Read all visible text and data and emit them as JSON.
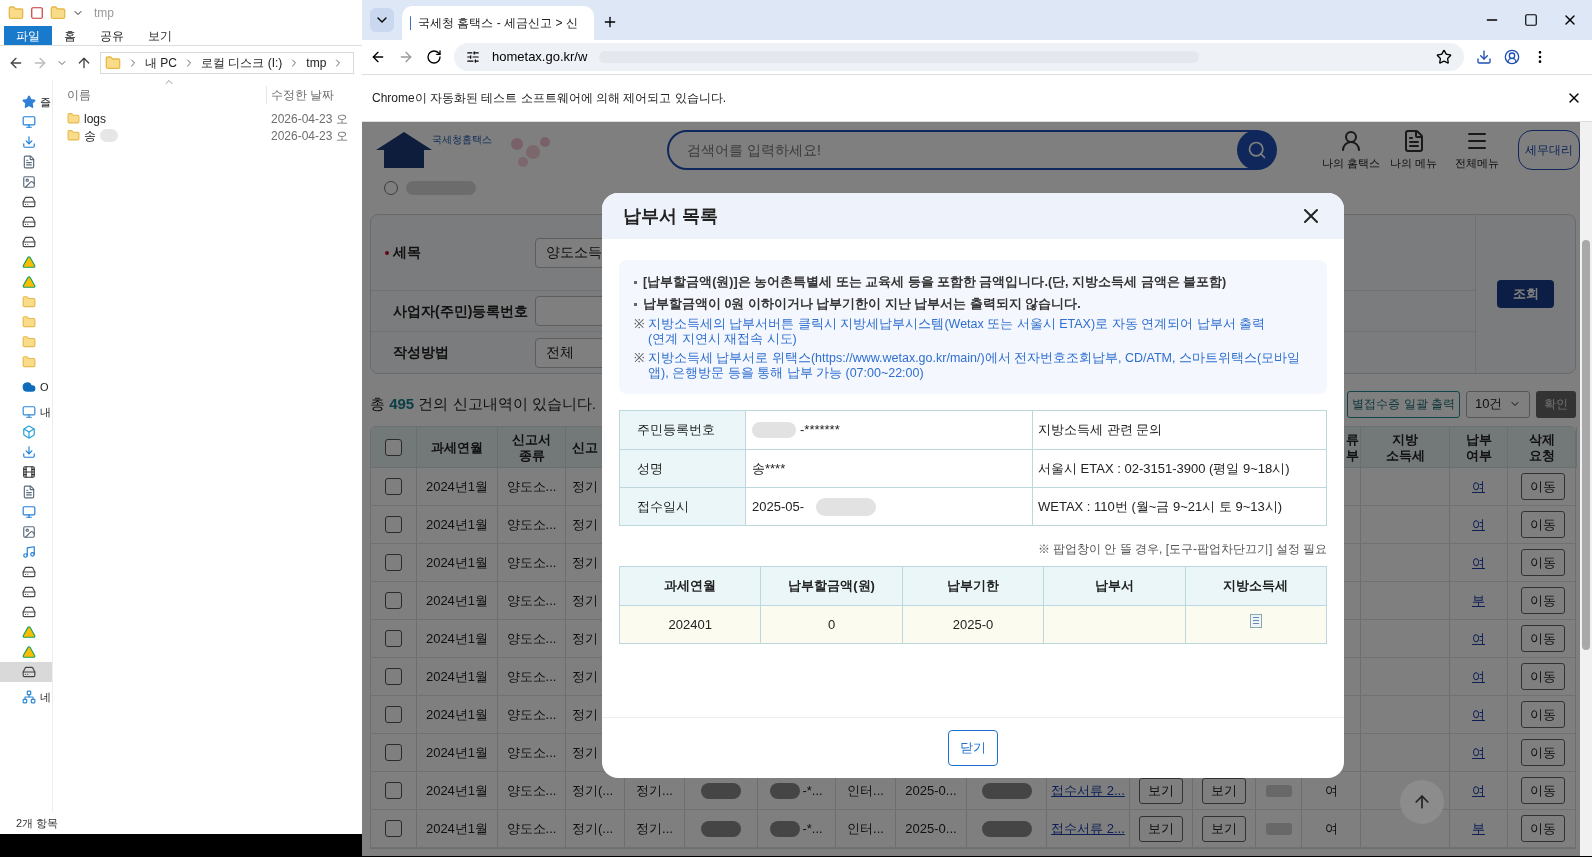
{
  "explorer": {
    "title": "tmp",
    "ribbon_tabs": [
      {
        "label": "파일",
        "selected": true
      },
      {
        "label": "홈",
        "selected": false
      },
      {
        "label": "공유",
        "selected": false
      },
      {
        "label": "보기",
        "selected": false
      }
    ],
    "breadcrumb": [
      "내 PC",
      "로컬 디스크 (I:)",
      "tmp"
    ],
    "columns": [
      "이름",
      "수정한 날짜"
    ],
    "files": [
      {
        "name": "logs",
        "modified": "2026-04-23 오",
        "redacted": false
      },
      {
        "name": "송",
        "modified": "2026-04-23 오",
        "redacted": true
      }
    ],
    "nav": [
      {
        "kind": "star",
        "label": "즐",
        "selected": false
      },
      {
        "kind": "desktop",
        "selected": false
      },
      {
        "kind": "download",
        "selected": false
      },
      {
        "kind": "document",
        "selected": false
      },
      {
        "kind": "picture",
        "selected": false
      },
      {
        "kind": "netdrive",
        "selected": false
      },
      {
        "kind": "netdrive",
        "selected": false
      },
      {
        "kind": "netdrive",
        "selected": false
      },
      {
        "kind": "gdrive",
        "selected": false
      },
      {
        "kind": "gdrive",
        "selected": false
      },
      {
        "kind": "cloudfolder",
        "selected": false
      },
      {
        "kind": "folder",
        "selected": false
      },
      {
        "kind": "folder",
        "selected": false
      },
      {
        "kind": "folder",
        "selected": false
      },
      {
        "kind": "onedrive",
        "label": "O",
        "selected": false
      },
      {
        "kind": "pc",
        "label": "내",
        "selected": false
      },
      {
        "kind": "cube",
        "selected": false
      },
      {
        "kind": "download",
        "selected": false
      },
      {
        "kind": "film",
        "selected": false
      },
      {
        "kind": "document",
        "selected": false
      },
      {
        "kind": "desktop",
        "selected": false
      },
      {
        "kind": "picture",
        "selected": false
      },
      {
        "kind": "music",
        "selected": false
      },
      {
        "kind": "drive",
        "selected": false
      },
      {
        "kind": "drive",
        "selected": false
      },
      {
        "kind": "drive",
        "selected": false
      },
      {
        "kind": "gdrive",
        "selected": false
      },
      {
        "kind": "gdrive",
        "selected": false
      },
      {
        "kind": "drive",
        "selected": true
      },
      {
        "kind": "network",
        "label": "네",
        "selected": false
      }
    ],
    "status": "2개 항목"
  },
  "browser": {
    "tab_title": "국세청 홈택스 - 세금신고 > 신",
    "url": "hometax.go.kr/w",
    "infobar": "Chrome이 자동화된 테스트 소프트웨어에 의해 제어되고 있습니다."
  },
  "site": {
    "logo_text": "국세청홈택스",
    "search_placeholder": "검색어를 입력하세요!",
    "nav": [
      {
        "kind": "user",
        "label": "나의 홈택스"
      },
      {
        "kind": "menu-user",
        "label": "나의 메뉴"
      },
      {
        "kind": "hamburger",
        "label": "전체메뉴"
      }
    ],
    "agent_button": "세무대리"
  },
  "filters": [
    {
      "label": "세목",
      "required": true,
      "kind": "select",
      "value": "양도소득"
    },
    {
      "label": "사업자(주민)등록번호",
      "required": false,
      "kind": "input"
    },
    {
      "label": "작성방법",
      "required": false,
      "kind": "select",
      "value": "전체"
    }
  ],
  "search_button": "조회",
  "summary": {
    "prefix": "총",
    "count": "495",
    "suffix": "건의 신고내역이 있습니다."
  },
  "bulk_print_button": "별접수증 일괄 출력",
  "page_size": "10건",
  "confirm_button": "확인",
  "table": {
    "header_checked": false,
    "columns": [
      "과세연월",
      "신고서\n종류",
      "신고",
      "류\n부",
      "지방\n소득세",
      "납부\n여부",
      "삭제\n요청"
    ],
    "rows": [
      {
        "checked": false,
        "period": "2024년1월",
        "form": "양도소...",
        "filing": "정기",
        "paid": "여",
        "delete": "이동"
      },
      {
        "checked": false,
        "period": "2024년1월",
        "form": "양도소...",
        "filing": "정기",
        "paid": "여",
        "delete": "이동"
      },
      {
        "checked": false,
        "period": "2024년1월",
        "form": "양도소...",
        "filing": "정기",
        "paid": "여",
        "delete": "이동"
      },
      {
        "checked": false,
        "period": "2024년1월",
        "form": "양도소...",
        "filing": "정기",
        "paid": "부",
        "delete": "이동"
      },
      {
        "checked": false,
        "period": "2024년1월",
        "form": "양도소...",
        "filing": "정기",
        "paid": "여",
        "delete": "이동"
      },
      {
        "checked": false,
        "period": "2024년1월",
        "form": "양도소...",
        "filing": "정기",
        "paid": "여",
        "delete": "이동"
      },
      {
        "checked": false,
        "period": "2024년1월",
        "form": "양도소...",
        "filing": "정기",
        "paid": "여",
        "delete": "이동"
      },
      {
        "checked": false,
        "period": "2024년1월",
        "form": "양도소...",
        "filing": "정기",
        "paid": "여",
        "delete": "이동"
      },
      {
        "checked": false,
        "period": "2024년1월",
        "form": "양도소...",
        "filing": "정기(...",
        "paid": "여",
        "delete": "이동",
        "details": {
          "method": "정기...",
          "masked_id": "-*...",
          "channel": "인터...",
          "date": "2025-0...",
          "receipt": "접수서류 2...",
          "view_buttons": [
            "보기",
            "보기"
          ],
          "col_14": "여"
        }
      },
      {
        "checked": false,
        "period": "2024년1월",
        "form": "양도소...",
        "filing": "정기(...",
        "paid": "부",
        "delete": "이동",
        "details": {
          "method": "정기...",
          "masked_id": "-*...",
          "channel": "인터...",
          "date": "2025-0...",
          "receipt": "접수서류 2...",
          "view_buttons": [
            "보기",
            "보기"
          ],
          "col_14": "여"
        }
      }
    ]
  },
  "modal": {
    "title": "납부서 목록",
    "notes": [
      {
        "kind": "bullet",
        "text": "[납부할금액(원)]은 농어촌특별세 또는 교육세 등을 포함한 금액입니다.(단, 지방소득세 금액은 불포함)"
      },
      {
        "kind": "bullet",
        "text": "납부할금액이 0원 이하이거나 납부기한이 지난 납부서는 출력되지 않습니다."
      },
      {
        "kind": "remark",
        "mark": "※",
        "text": "지방소득세의 납부서버튼 클릭시 지방세납부시스템(Wetax 또는 서울시 ETAX)로 자동 연계되어 납부서 출력\n(연계 지연시 재접속 시도)"
      },
      {
        "kind": "remark",
        "mark": "※",
        "text": "지방소득세 납부서로 위택스(https://www.wetax.go.kr/main/)에서 전자번호조회납부, CD/ATM, 스마트위택스(모바일앱), 은행방문 등을 통해 납부 가능 (07:00~22:00)"
      }
    ],
    "info": [
      {
        "label": "주민등록번호",
        "value": "-*******",
        "masked_prefix": true,
        "masked_suffix": false,
        "contact": "지방소득세 관련 문의"
      },
      {
        "label": "성명",
        "value": "송****",
        "masked_prefix": false,
        "masked_suffix": false,
        "contact": "서울시 ETAX : 02-3151-3900 (평일 9~18시)"
      },
      {
        "label": "접수일시",
        "value": "2025-05-",
        "masked_prefix": false,
        "masked_suffix": true,
        "contact": "WETAX : 110번 (월~금 9~21시 토 9~13시)"
      }
    ],
    "popup_note": "※ 팝업창이 안 뜰 경우, [도구-팝업차단끄기] 설정 필요",
    "bills": {
      "columns": [
        "과세연월",
        "납부할금액(원)",
        "납부기한",
        "납부서",
        "지방소득세"
      ],
      "rows": [
        {
          "period": "202401",
          "amount": "0",
          "due": "2025-0",
          "local_tax_doc": true
        }
      ]
    },
    "close_button": "닫기"
  }
}
